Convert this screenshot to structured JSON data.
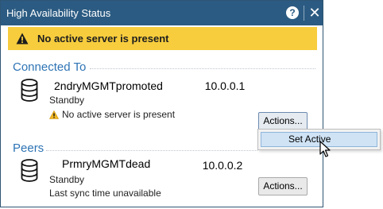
{
  "window": {
    "title": "High Availability Status",
    "help_label": "?",
    "close_label": "✕"
  },
  "banner": {
    "text": "No active server is present",
    "icon": "warning-icon",
    "color": "#f7cd3e"
  },
  "connected": {
    "section_title": "Connected To",
    "server_name": "2ndryMGMTpromoted",
    "ip": "10.0.0.1",
    "role": "Standby",
    "status": "No active server is present",
    "status_icon": "warning-icon",
    "actions_label": "Actions..."
  },
  "actions_menu": {
    "items": [
      {
        "label": "Set Active"
      }
    ]
  },
  "peers": {
    "section_title": "Peers",
    "server_name": "PrmryMGMTdead",
    "ip": "10.0.0.2",
    "role": "Standby",
    "status": "Last sync time unavailable",
    "actions_label": "Actions..."
  },
  "colors": {
    "titlebar": "#2b5b82",
    "section_title": "#2e74b5",
    "menu_highlight": "#cfe3f5"
  }
}
